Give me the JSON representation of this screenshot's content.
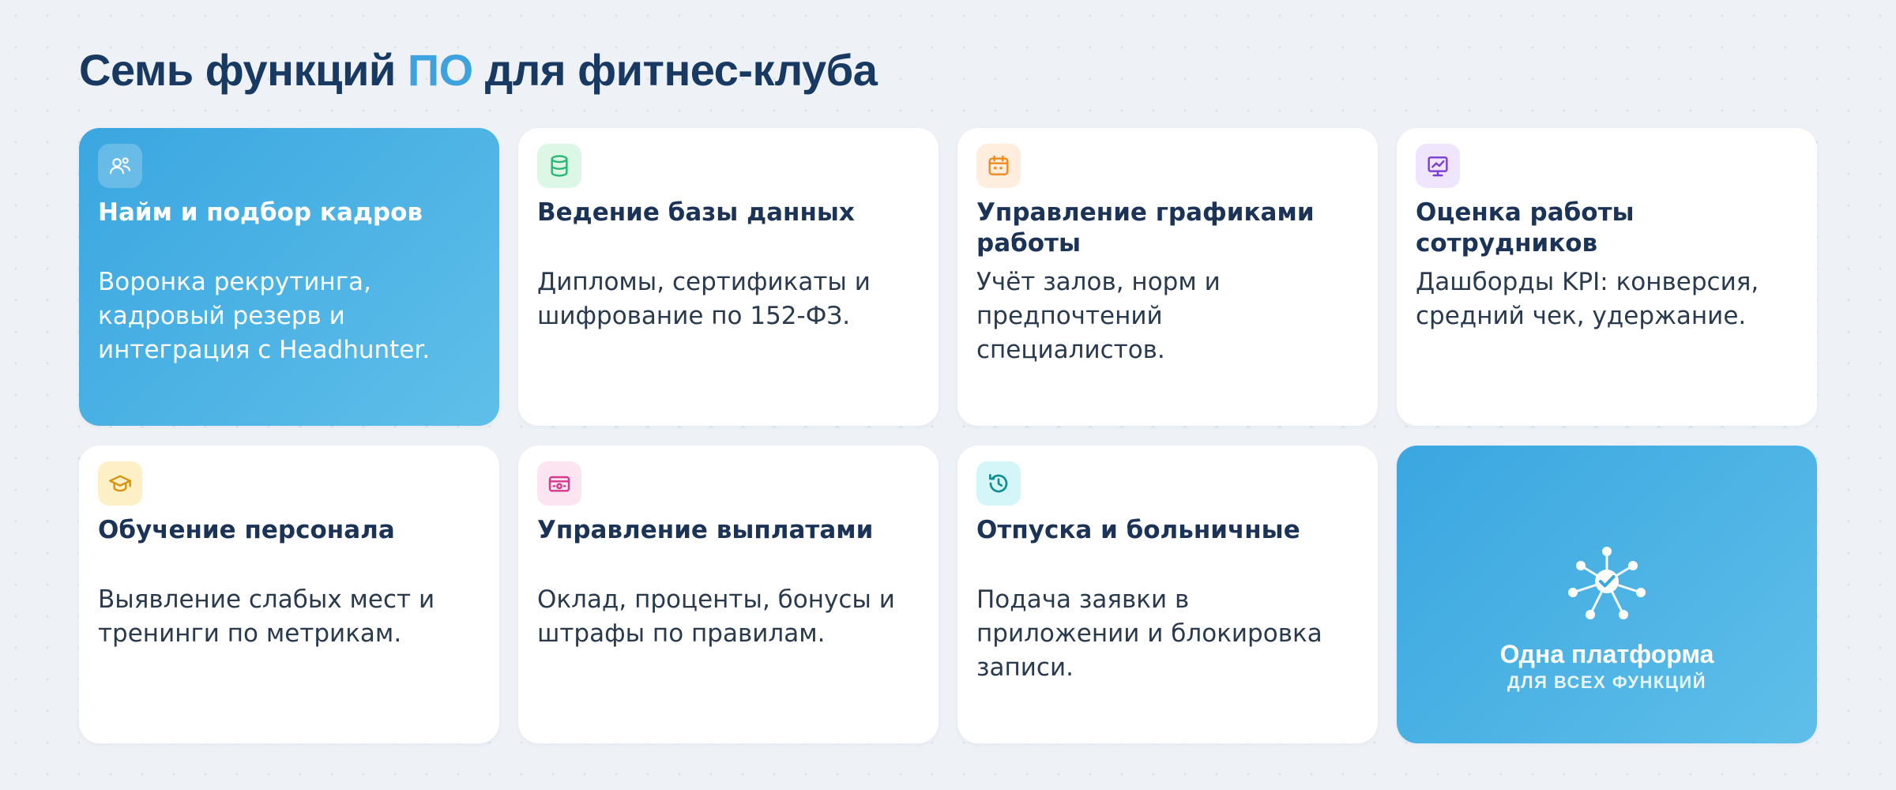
{
  "header": {
    "title_before": "Семь функций ",
    "title_accent": "ПО",
    "title_after": " для фитнес-клуба"
  },
  "colors": {
    "accent": "#3da2dd",
    "title": "#183a62",
    "card_highlight": "#4ab0e4"
  },
  "cards": [
    {
      "icon": "users-icon",
      "title": "Найм и подбор кадров",
      "desc": "Воронка рекрутинга, кадровый резерв и интеграция с Headhunter."
    },
    {
      "icon": "database-icon",
      "title": "Ведение базы данных",
      "desc": "Дипломы, сертификаты и шифрование по 152-ФЗ."
    },
    {
      "icon": "calendar-icon",
      "title": "Управление графиками работы",
      "desc": "Учёт залов, норм и предпочтений специалистов."
    },
    {
      "icon": "chart-icon",
      "title": "Оценка работы сотрудников",
      "desc": "Дашборды KPI: конверсия, средний чек, удержание."
    },
    {
      "icon": "graduation-cap-icon",
      "title": "Обучение персонала",
      "desc": "Выявление слабых мест и тренинги по метрикам."
    },
    {
      "icon": "wallet-icon",
      "title": "Управление выплатами",
      "desc": "Оклад, проценты, бонусы и штрафы по правилам."
    },
    {
      "icon": "history-icon",
      "title": "Отпуска и больничные",
      "desc": "Подача заявки в приложении и блокировка записи."
    }
  ],
  "platform": {
    "icon": "network-check-icon",
    "title": "Одна платформа",
    "subtitle": "ДЛЯ ВСЕХ ФУНКЦИЙ"
  }
}
